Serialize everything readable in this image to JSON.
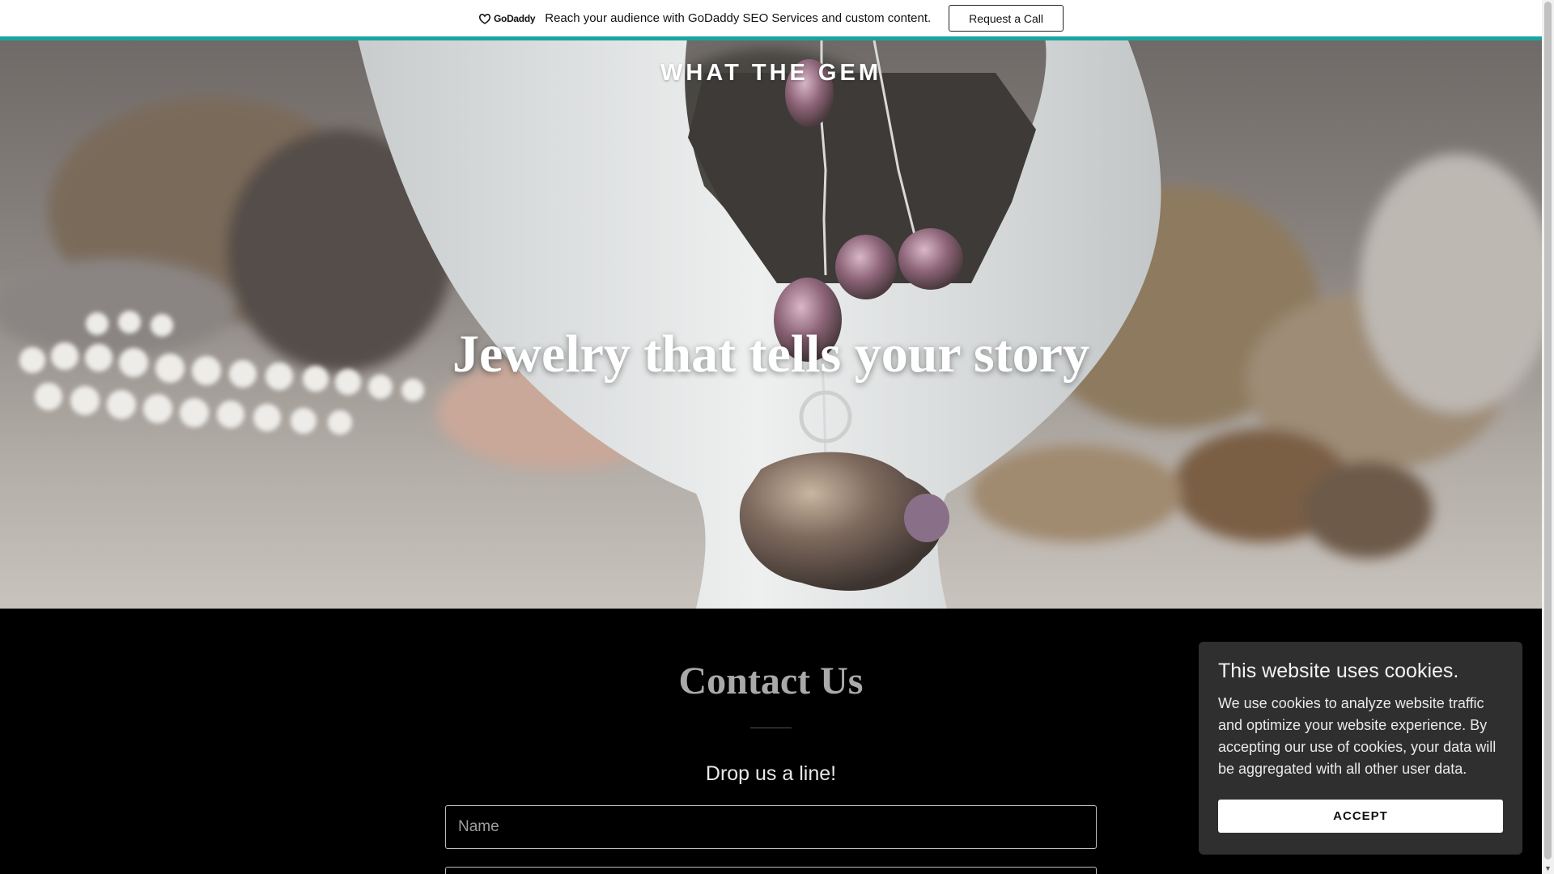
{
  "promo_bar": {
    "logo_text": "GoDaddy",
    "message": "Reach your audience with GoDaddy SEO Services and custom content.",
    "button_label": "Request a Call",
    "accent_color": "#1aa5a0"
  },
  "hero": {
    "site_title": "WHAT THE GEM",
    "heading": "Jewelry that tells your story"
  },
  "contact": {
    "title": "Contact Us",
    "subtitle": "Drop us a line!",
    "name_placeholder": "Name",
    "email_placeholder": ""
  },
  "cookie_banner": {
    "title": "This website uses cookies.",
    "body": "We use cookies to analyze website traffic and optimize your website experience. By accepting our use of cookies, your data will be aggregated with all other user data.",
    "accept_label": "ACCEPT"
  },
  "icons": [
    "godaddy-logo-icon",
    "scroll-down-arrow-icon"
  ]
}
